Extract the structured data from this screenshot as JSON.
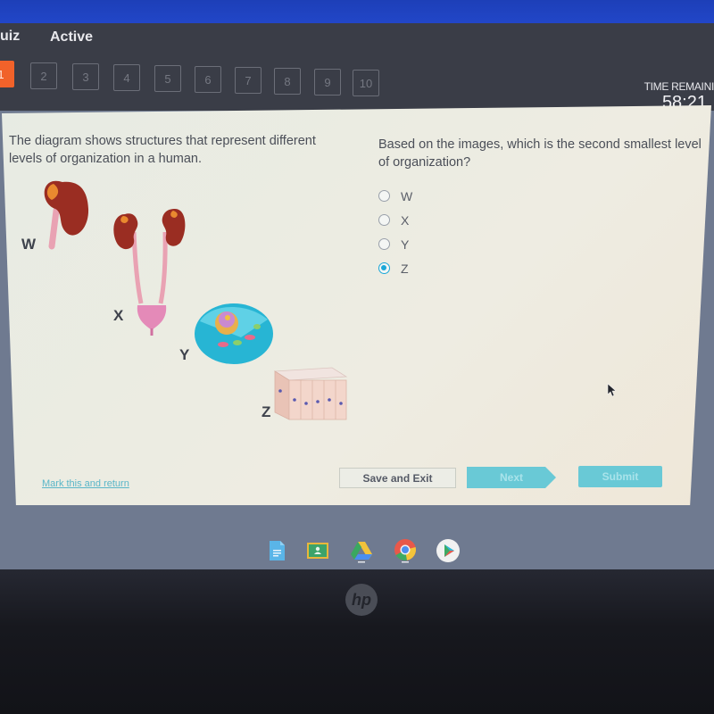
{
  "app": {
    "title": "uiz",
    "status": "Active"
  },
  "question_nav": {
    "items": [
      "1",
      "2",
      "3",
      "4",
      "5",
      "6",
      "7",
      "8",
      "9",
      "10"
    ],
    "active_index": 0
  },
  "timer": {
    "label": "TIME REMAINI",
    "value": "58:21"
  },
  "question": {
    "stem": "The diagram shows structures that represent different levels of organization in a human.",
    "prompt": "Based on the images, which is the second smallest level of organization?",
    "diagram_labels": {
      "w": "W",
      "x": "X",
      "y": "Y",
      "z": "Z"
    },
    "diagram_items": [
      {
        "label": "W",
        "depicts": "kidney"
      },
      {
        "label": "X",
        "depicts": "urinary system (kidneys, ureters, bladder)"
      },
      {
        "label": "Y",
        "depicts": "animal cell"
      },
      {
        "label": "Z",
        "depicts": "epithelial tissue"
      }
    ],
    "options": [
      {
        "label": "W",
        "selected": false
      },
      {
        "label": "X",
        "selected": false
      },
      {
        "label": "Y",
        "selected": false
      },
      {
        "label": "Z",
        "selected": true
      }
    ]
  },
  "footer": {
    "mark_link": "Mark this and return",
    "save_exit": "Save and Exit",
    "next": "Next",
    "submit": "Submit"
  },
  "shelf": {
    "apps": [
      "docs-icon",
      "classroom-icon",
      "drive-icon",
      "chrome-icon",
      "play-store-icon"
    ]
  },
  "bezel": {
    "logo": "hp"
  },
  "colors": {
    "active_question": "#f1622a",
    "accent_teal": "#69c9d6",
    "radio_selected": "#1ca8d8",
    "header_bg": "#3a3d47",
    "title_bar": "#2247c9"
  }
}
